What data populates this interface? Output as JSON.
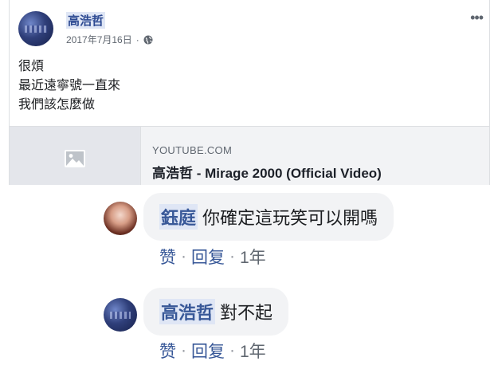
{
  "post": {
    "author": "高浩哲",
    "date": "2017年7月16日",
    "privacy_icon": "globe-icon",
    "more": "•••",
    "lines": [
      "很煩",
      "最近遠寧號一直來",
      "我們該怎麼做"
    ],
    "link": {
      "thumbnail_icon": "image-icon",
      "domain": "YOUTUBE.COM",
      "title": "高浩哲 - Mirage 2000 (Official Video)"
    }
  },
  "comments": [
    {
      "author": "鈺庭",
      "text": "你確定這玩笑可以開嗎",
      "like": "赞",
      "reply": "回复",
      "time": "1年"
    },
    {
      "author": "高浩哲",
      "text": "對不起",
      "like": "赞",
      "reply": "回复",
      "time": "1年"
    }
  ],
  "colors": {
    "link_blue": "#385898",
    "bubble_bg": "#f2f3f5",
    "meta_gray": "#606770"
  }
}
